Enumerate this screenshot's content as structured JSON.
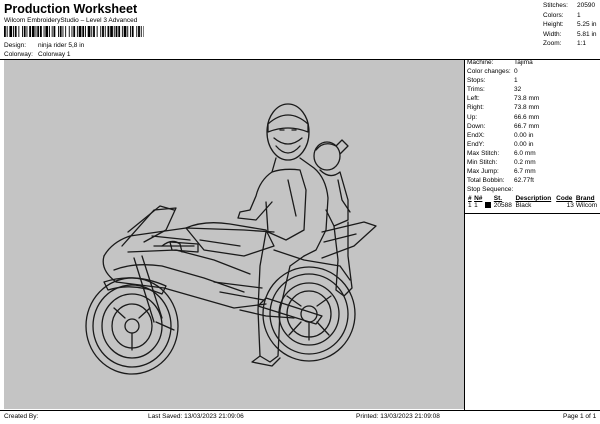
{
  "header": {
    "title": "Production Worksheet",
    "subtitle": "Wilcom EmbroideryStudio – Level 3 Advanced",
    "design_label": "Design:",
    "design_value": "ninja rider 5,8 in",
    "colorway_label": "Colorway:",
    "colorway_value": "Colorway 1"
  },
  "stats": [
    {
      "label": "Stitches:",
      "value": "20590"
    },
    {
      "label": "Colors:",
      "value": "1"
    },
    {
      "label": "Height:",
      "value": "5.25 in"
    },
    {
      "label": "Width:",
      "value": "5.81 in"
    },
    {
      "label": "Zoom:",
      "value": "1:1"
    }
  ],
  "machine_info": [
    {
      "label": "Machine:",
      "value": "Tajima"
    },
    {
      "label": "Color changes:",
      "value": "0"
    },
    {
      "label": "Stops:",
      "value": "1"
    },
    {
      "label": "Trims:",
      "value": "32"
    },
    {
      "label": "Left:",
      "value": "73.8 mm"
    },
    {
      "label": "Right:",
      "value": "73.8 mm"
    },
    {
      "label": "Up:",
      "value": "66.6 mm"
    },
    {
      "label": "Down:",
      "value": "66.7 mm"
    },
    {
      "label": "EndX:",
      "value": "0.00 in"
    },
    {
      "label": "EndY:",
      "value": "0.00 in"
    },
    {
      "label": "Max Stitch:",
      "value": "6.0 mm"
    },
    {
      "label": "Min Stitch:",
      "value": "0.2 mm"
    },
    {
      "label": "Max Jump:",
      "value": "6.7 mm"
    },
    {
      "label": "Total Bobbin:",
      "value": "62.77ft"
    }
  ],
  "stop_sequence": {
    "title": "Stop Sequence:",
    "columns": [
      "#",
      "N#",
      "",
      "St.",
      "Description",
      "Code",
      "Brand"
    ],
    "rows": [
      {
        "num": "1",
        "needle": "1",
        "stitches": "20588",
        "description": "Black",
        "code": "13",
        "brand": "Wilcom",
        "color": "#000000"
      }
    ]
  },
  "footer": {
    "created_by": "Created By:",
    "last_saved": "Last Saved: 13/03/2023 21:09:06",
    "printed": "Printed: 13/03/2023 21:09:08",
    "page": "Page 1 of 1"
  },
  "colors": {
    "canvas_bg": "#c4c4c4",
    "thread": "#1a1a1a"
  }
}
